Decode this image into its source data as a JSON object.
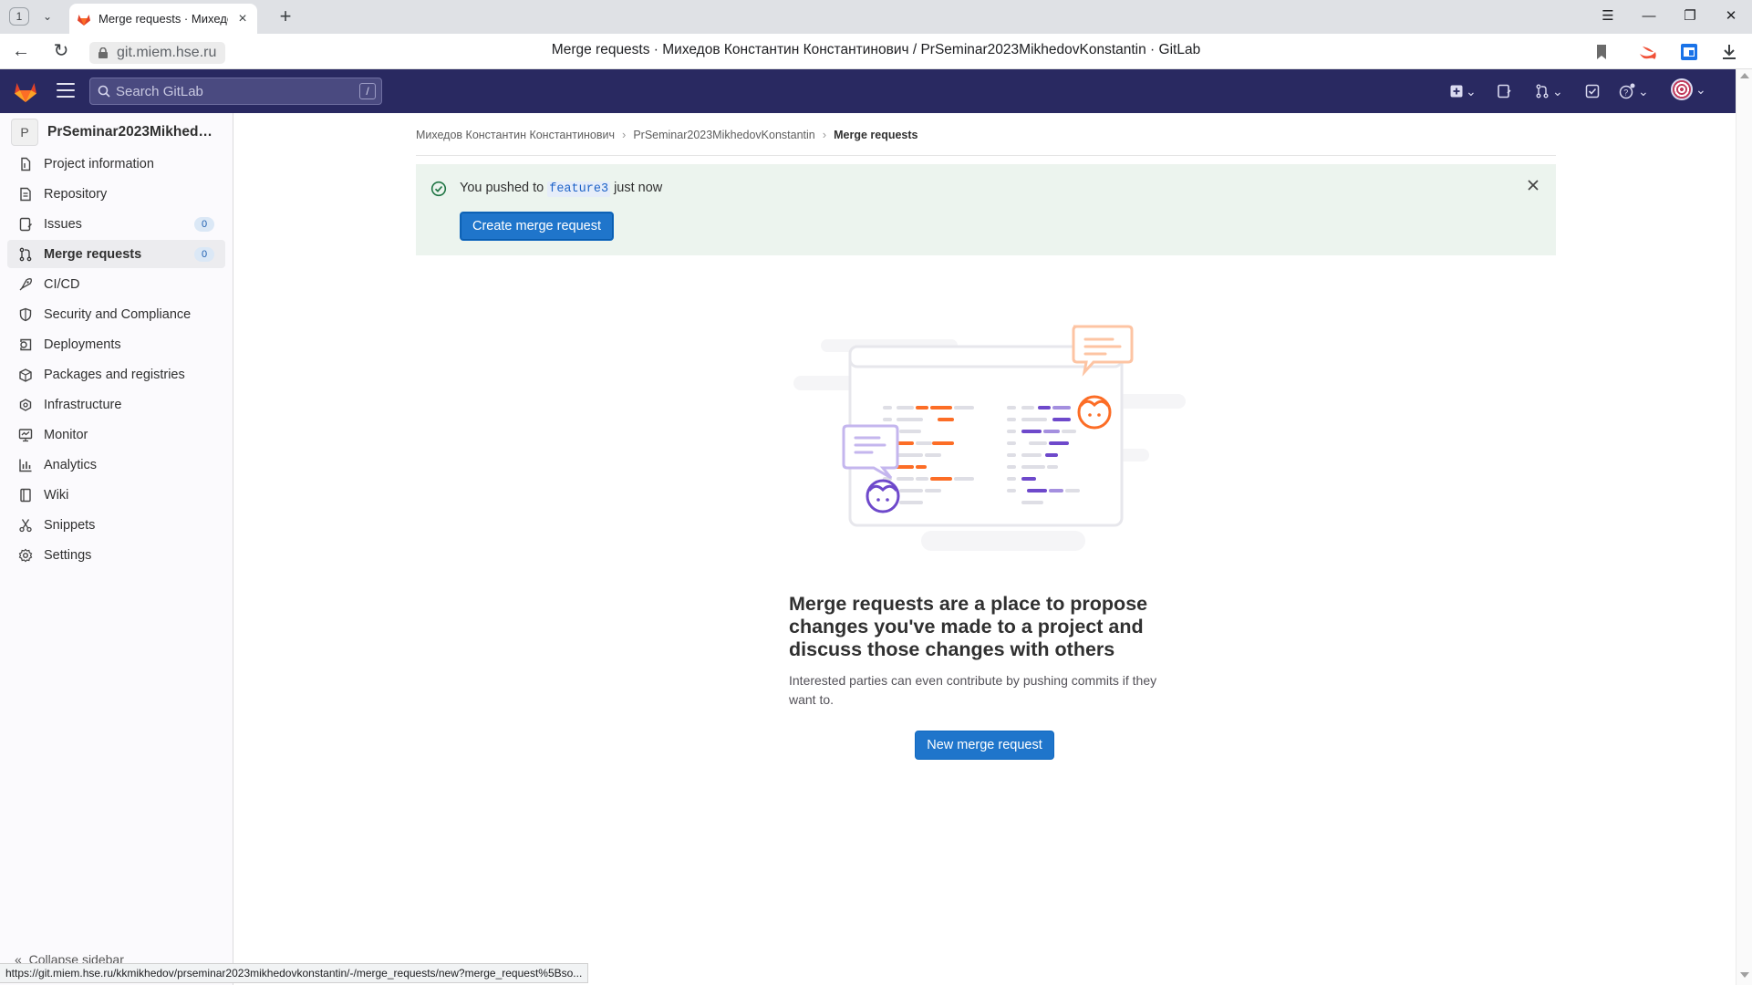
{
  "browser": {
    "tab_count": "1",
    "tab_title": "Merge requests · Михедов Константин Константинович / PrSeminar2023MikhedovKonstantin · GitLab",
    "url": "git.miem.hse.ru",
    "page_title": "Merge requests · Михедов Константин Константинович / PrSeminar2023MikhedovKonstantin · GitLab",
    "status_url": "https://git.miem.hse.ru/kkmikhedov/prseminar2023mikhedovkonstantin/-/merge_requests/new?merge_request%5Bso..."
  },
  "header": {
    "search_placeholder": "Search GitLab",
    "search_shortcut": "/"
  },
  "sidebar": {
    "project_initial": "P",
    "project_name": "PrSeminar2023MikhedovKonstantin",
    "items": [
      {
        "label": "Project information",
        "icon": "info-icon"
      },
      {
        "label": "Repository",
        "icon": "doc-icon"
      },
      {
        "label": "Issues",
        "icon": "issues-icon",
        "badge": "0"
      },
      {
        "label": "Merge requests",
        "icon": "merge-request-icon",
        "badge": "0",
        "active": true
      },
      {
        "label": "CI/CD",
        "icon": "rocket-icon"
      },
      {
        "label": "Security and Compliance",
        "icon": "shield-icon"
      },
      {
        "label": "Deployments",
        "icon": "deployments-icon"
      },
      {
        "label": "Packages and registries",
        "icon": "package-icon"
      },
      {
        "label": "Infrastructure",
        "icon": "cloud-icon"
      },
      {
        "label": "Monitor",
        "icon": "monitor-icon"
      },
      {
        "label": "Analytics",
        "icon": "chart-icon"
      },
      {
        "label": "Wiki",
        "icon": "book-icon"
      },
      {
        "label": "Snippets",
        "icon": "scissors-icon"
      },
      {
        "label": "Settings",
        "icon": "gear-icon"
      }
    ],
    "collapse_label": "Collapse sidebar"
  },
  "breadcrumb": {
    "items": [
      "Михедов Константин Константинович",
      "PrSeminar2023MikhedovKonstantin",
      "Merge requests"
    ]
  },
  "alert": {
    "prefix": "You pushed to",
    "branch": "feature3",
    "suffix": "just now",
    "button": "Create merge request"
  },
  "empty_state": {
    "title": "Merge requests are a place to propose changes you've made to a project and discuss those changes with others",
    "description": "Interested parties can even contribute by pushing commits if they want to.",
    "button": "New merge request"
  },
  "colors": {
    "header_bg": "#292961",
    "primary": "#1f75cb",
    "alert_bg": "#ecf4ee",
    "sidebar_bg": "#fbfafd",
    "illustration_orange": "#fc6d26",
    "illustration_purple": "#6e49cb"
  }
}
